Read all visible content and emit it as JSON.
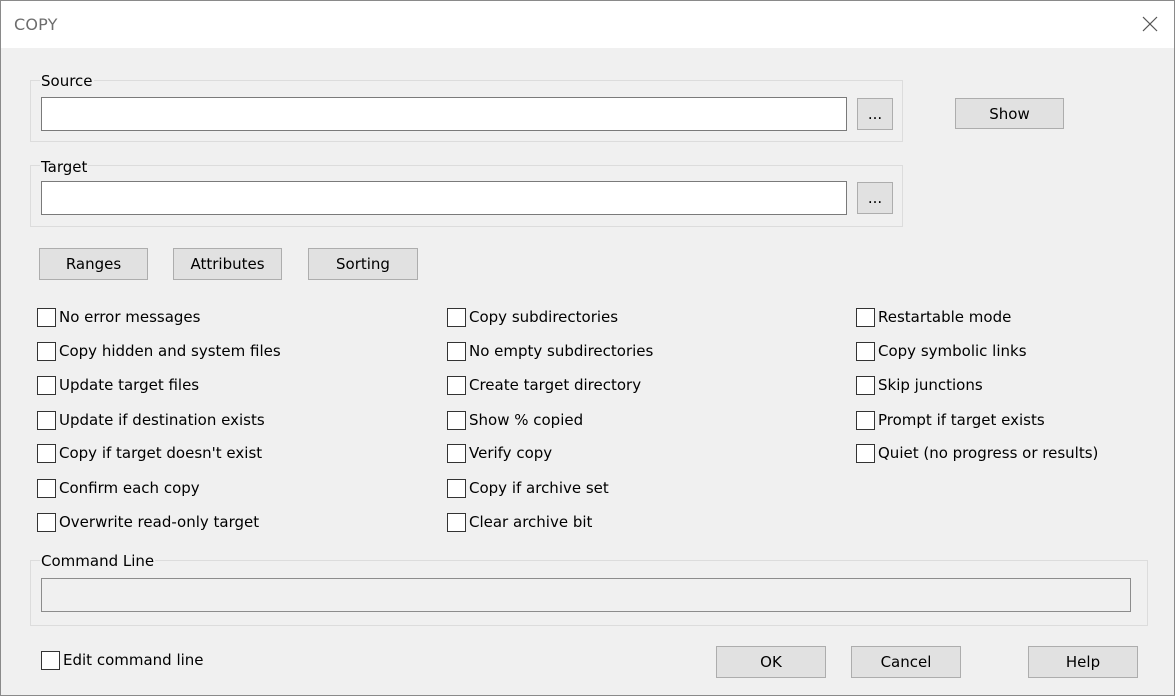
{
  "window": {
    "title": "COPY"
  },
  "source": {
    "label": "Source",
    "value": "",
    "browse_label": "..."
  },
  "target": {
    "label": "Target",
    "value": "",
    "browse_label": "..."
  },
  "buttons": {
    "show": "Show",
    "ranges": "Ranges",
    "attributes": "Attributes",
    "sorting": "Sorting",
    "ok": "OK",
    "cancel": "Cancel",
    "help": "Help"
  },
  "options": {
    "col1": [
      {
        "label": "No error messages",
        "checked": false
      },
      {
        "label": "Copy hidden and system files",
        "checked": false
      },
      {
        "label": "Update target files",
        "checked": false
      },
      {
        "label": "Update if destination exists",
        "checked": false
      },
      {
        "label": "Copy if target doesn't exist",
        "checked": false
      },
      {
        "label": "Confirm each copy",
        "checked": false
      },
      {
        "label": "Overwrite read-only target",
        "checked": false
      }
    ],
    "col2": [
      {
        "label": "Copy subdirectories",
        "checked": false
      },
      {
        "label": "No empty subdirectories",
        "checked": false
      },
      {
        "label": "Create target directory",
        "checked": false
      },
      {
        "label": "Show % copied",
        "checked": false
      },
      {
        "label": "Verify copy",
        "checked": false
      },
      {
        "label": "Copy if archive set",
        "checked": false
      },
      {
        "label": "Clear archive bit",
        "checked": false
      }
    ],
    "col3": [
      {
        "label": "Restartable mode",
        "checked": false
      },
      {
        "label": "Copy symbolic links",
        "checked": false
      },
      {
        "label": "Skip junctions",
        "checked": false
      },
      {
        "label": "Prompt if target exists",
        "checked": false
      },
      {
        "label": "Quiet (no progress or results)",
        "checked": false
      }
    ]
  },
  "command_line": {
    "label": "Command Line",
    "value": ""
  },
  "edit_command_line": {
    "label": "Edit command line",
    "checked": false
  }
}
